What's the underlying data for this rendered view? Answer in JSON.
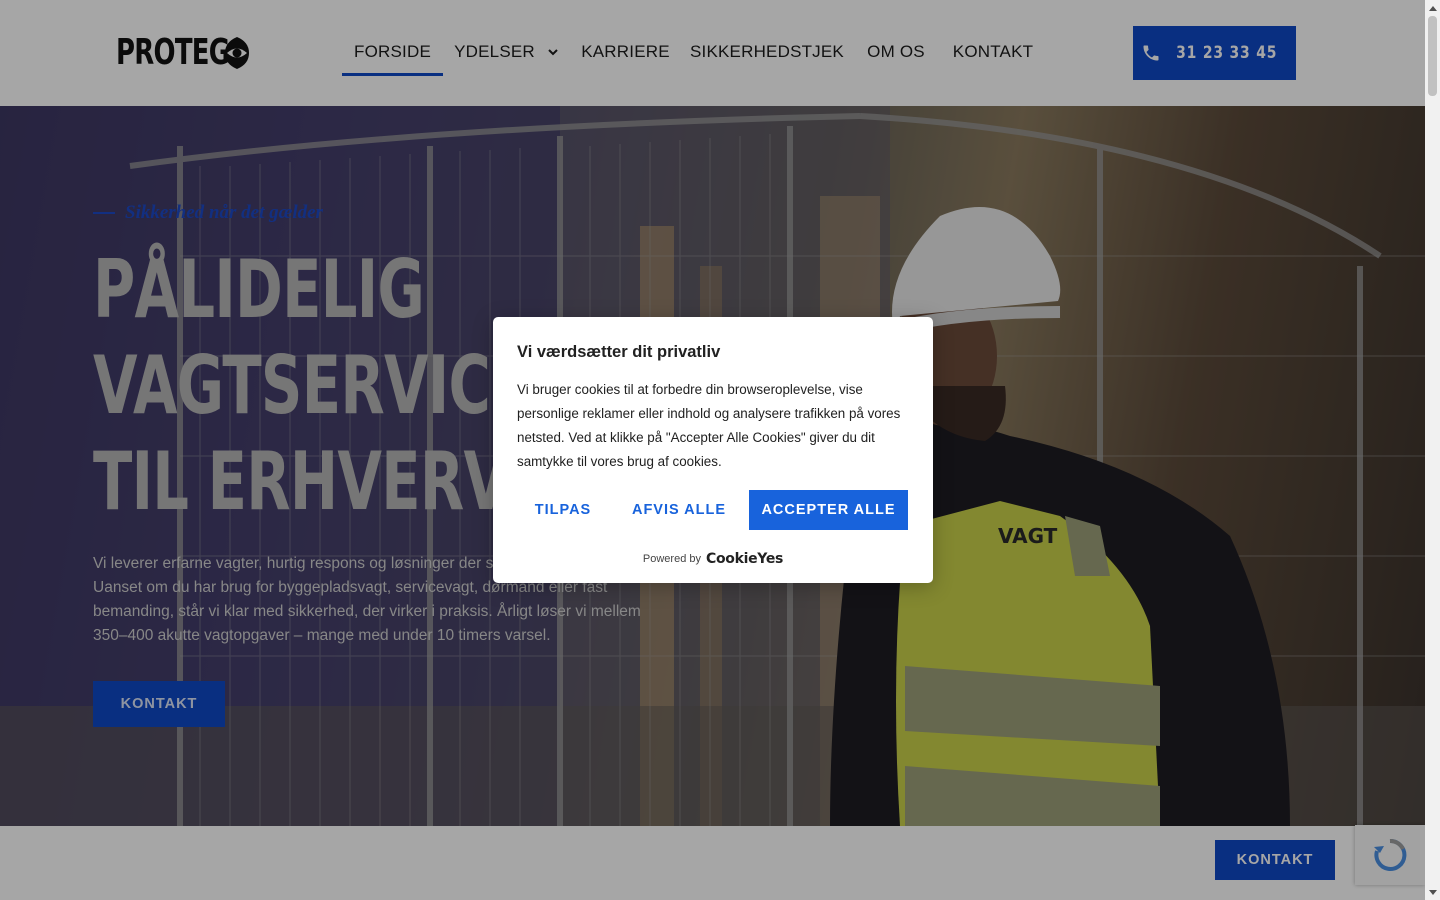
{
  "header": {
    "logo_text": "PROTEG",
    "nav": [
      {
        "label": "FORSIDE",
        "active": true
      },
      {
        "label": "YDELSER",
        "has_dropdown": true
      },
      {
        "label": "KARRIERE"
      },
      {
        "label": "SIKKERHEDSTJEK"
      },
      {
        "label": "OM OS"
      },
      {
        "label": "KONTAKT"
      }
    ],
    "phone": "31 23 33 45"
  },
  "hero": {
    "tagline": "Sikkerhed når det gælder",
    "title_lines": [
      "PÅLIDELIG",
      "VAGTSERVICE",
      "TIL ERHVERV"
    ],
    "text": "Vi leverer erfarne vagter, hurtig respons og løsninger der skal fungere i hverdagen. Uanset om du har brug for byggepladsvagt, servicevagt, dørmand eller fast bemanding, står vi klar med sikkerhed, der virker i praksis. Årligt løser vi mellem 350–400 akutte vagtopgaver – mange med under 10 timers varsel.",
    "cta": "KONTAKT",
    "vest_text": "VAGT"
  },
  "cookie_modal": {
    "title": "Vi værdsætter dit privatliv",
    "body": "Vi bruger cookies til at forbedre din browseroplevelse, vise personlige reklamer eller indhold og analysere trafikken på vores netsted. Ved at klikke på \"Accepter Alle Cookies\" giver du dit samtykke til vores brug af cookies.",
    "customize": "TILPAS",
    "reject": "AFVIS ALLE",
    "accept": "ACCEPTER ALLE",
    "powered_by": "Powered by",
    "brand": "CookieYes"
  },
  "sticky_cta": "KONTAKT",
  "colors": {
    "brand_blue": "#0f49c7",
    "cookie_blue": "#1863dc",
    "vest_yellow": "#c9d24a"
  },
  "icons": [
    "phone-icon",
    "chevron-down-icon",
    "logo-eye-icon",
    "recaptcha-icon"
  ]
}
